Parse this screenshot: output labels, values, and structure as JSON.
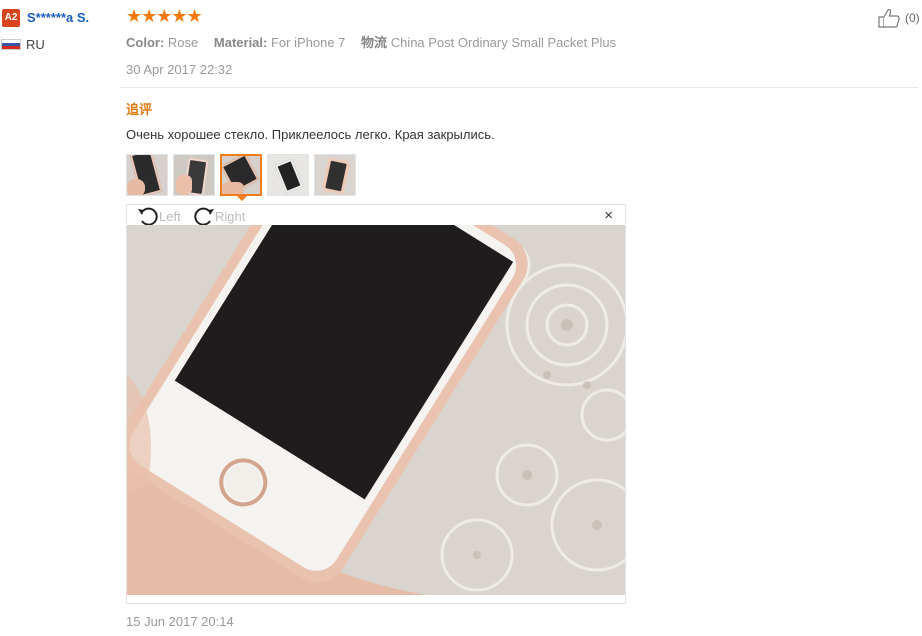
{
  "user": {
    "badge": "A2",
    "name": "S******a S.",
    "country": "RU"
  },
  "rating": {
    "stars": "★★★★★"
  },
  "attributes": [
    {
      "key": "Color:",
      "value": "Rose"
    },
    {
      "key": "Material:",
      "value": "For iPhone 7"
    },
    {
      "key": "物流",
      "value": "China Post Ordinary Small Packet Plus"
    }
  ],
  "review_date": "30 Apr 2017 22:32",
  "helpful": {
    "count": "(0)"
  },
  "followup": {
    "label": "追评",
    "text": "Очень хорошее стекло. Приклеелось легко. Края закрылись."
  },
  "viewer": {
    "rotate_left": "Left",
    "rotate_right": "Right",
    "close": "×"
  },
  "followup_date": "15 Jun 2017 20:14",
  "colors": {
    "link": "#1b5ebd",
    "star": "#f7790b",
    "accent": "#f07c1b",
    "badge": "#d9461e"
  }
}
